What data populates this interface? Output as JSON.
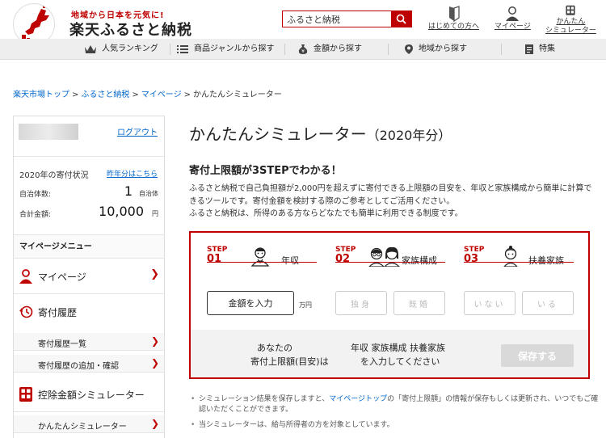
{
  "header": {
    "tagline": "地域から日本を元気に!",
    "brand": "楽天ふるさと納税",
    "search_value": "ふるさと納税",
    "links": [
      {
        "label": "はじめての方へ"
      },
      {
        "label": "マイページ"
      },
      {
        "label_line1": "かんたん",
        "label_line2": "シミュレーター"
      }
    ]
  },
  "nav": {
    "items": [
      {
        "label": "人気ランキング"
      },
      {
        "label": "商品ジャンルから探す"
      },
      {
        "label": "金額から探す"
      },
      {
        "label": "地域から探す"
      },
      {
        "label": "特集"
      }
    ]
  },
  "breadcrumb": {
    "items": [
      "楽天市場トップ",
      "ふるさと納税",
      "マイページ"
    ],
    "current": "かんたんシミュレーター",
    "separator": ">"
  },
  "sidebar": {
    "logout": "ログアウト",
    "status_title": "2020年の寄付状況",
    "prev_year": "昨年分はこちら",
    "municipalities_label": "自治体数:",
    "municipalities_value": "1",
    "municipalities_unit": "自治体",
    "total_label": "合計金額:",
    "total_value": "10,000",
    "total_unit": "円",
    "menu_title": "マイページメニュー",
    "menu": {
      "mypage": "マイページ",
      "history": "寄付履歴",
      "history_list": "寄付履歴一覧",
      "history_add": "寄付履歴の追加・確認",
      "deduction_sim": "控除金額シミュレーター",
      "easy_sim": "かんたんシミュレーター"
    }
  },
  "main": {
    "title": "かんたんシミュレーター",
    "title_year": "（2020年分）",
    "subtitle": "寄付上限額が3STEPでわかる！",
    "desc_1": "ふるさと納税で自己負担額が2,000円を超えずに寄付できる上限額の目安を、年収と家族構成から簡単に計算できるツールです。寄付金額を検討する際のご参考としてご活用ください。",
    "desc_2": "ふるさと納税は、所得のある方ならどなたでも簡単に利用できる制度です。",
    "steps": [
      {
        "step": "STEP",
        "num": "01",
        "label": "年収"
      },
      {
        "step": "STEP",
        "num": "02",
        "label": "家族構成"
      },
      {
        "step": "STEP",
        "num": "03",
        "label": "扶養家族"
      }
    ],
    "income_button": "金額を入力",
    "yen_unit": "万円",
    "family": [
      "独身",
      "既婚"
    ],
    "dependents": [
      "いない",
      "いる"
    ],
    "result_label_1": "あなたの",
    "result_label_2": "寄付上限額(目安)は",
    "result_msg_1": "年収 家族構成 扶養家族",
    "result_msg_2": "を入力してください",
    "save": "保存する",
    "note_1_prefix": "シミュレーション結果を保存しますと、",
    "note_1_link": "マイページトップ",
    "note_1_suffix": "の「寄付上限額」の情報が保存もしくは更新され、いつでもご確認いただくことができます。",
    "note_2": "当シミュレーターは、給与所得者の方を対象としています。"
  },
  "colors": {
    "brand_red": "#bf0000",
    "link_blue": "#0066cc"
  }
}
